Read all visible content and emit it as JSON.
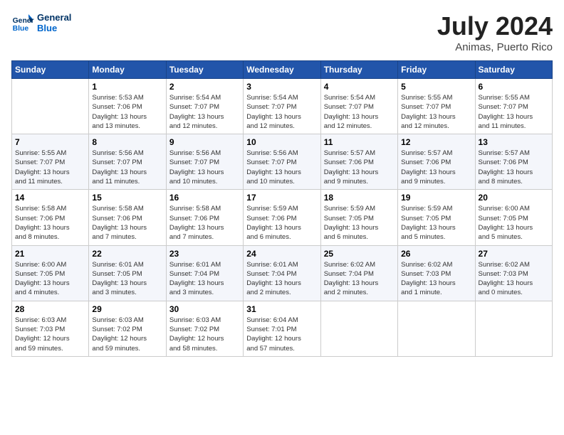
{
  "header": {
    "logo_line1": "General",
    "logo_line2": "Blue",
    "month_title": "July 2024",
    "location": "Animas, Puerto Rico"
  },
  "weekdays": [
    "Sunday",
    "Monday",
    "Tuesday",
    "Wednesday",
    "Thursday",
    "Friday",
    "Saturday"
  ],
  "weeks": [
    [
      {
        "day": "",
        "info": ""
      },
      {
        "day": "1",
        "info": "Sunrise: 5:53 AM\nSunset: 7:06 PM\nDaylight: 13 hours\nand 13 minutes."
      },
      {
        "day": "2",
        "info": "Sunrise: 5:54 AM\nSunset: 7:07 PM\nDaylight: 13 hours\nand 12 minutes."
      },
      {
        "day": "3",
        "info": "Sunrise: 5:54 AM\nSunset: 7:07 PM\nDaylight: 13 hours\nand 12 minutes."
      },
      {
        "day": "4",
        "info": "Sunrise: 5:54 AM\nSunset: 7:07 PM\nDaylight: 13 hours\nand 12 minutes."
      },
      {
        "day": "5",
        "info": "Sunrise: 5:55 AM\nSunset: 7:07 PM\nDaylight: 13 hours\nand 12 minutes."
      },
      {
        "day": "6",
        "info": "Sunrise: 5:55 AM\nSunset: 7:07 PM\nDaylight: 13 hours\nand 11 minutes."
      }
    ],
    [
      {
        "day": "7",
        "info": "Sunrise: 5:55 AM\nSunset: 7:07 PM\nDaylight: 13 hours\nand 11 minutes."
      },
      {
        "day": "8",
        "info": "Sunrise: 5:56 AM\nSunset: 7:07 PM\nDaylight: 13 hours\nand 11 minutes."
      },
      {
        "day": "9",
        "info": "Sunrise: 5:56 AM\nSunset: 7:07 PM\nDaylight: 13 hours\nand 10 minutes."
      },
      {
        "day": "10",
        "info": "Sunrise: 5:56 AM\nSunset: 7:07 PM\nDaylight: 13 hours\nand 10 minutes."
      },
      {
        "day": "11",
        "info": "Sunrise: 5:57 AM\nSunset: 7:06 PM\nDaylight: 13 hours\nand 9 minutes."
      },
      {
        "day": "12",
        "info": "Sunrise: 5:57 AM\nSunset: 7:06 PM\nDaylight: 13 hours\nand 9 minutes."
      },
      {
        "day": "13",
        "info": "Sunrise: 5:57 AM\nSunset: 7:06 PM\nDaylight: 13 hours\nand 8 minutes."
      }
    ],
    [
      {
        "day": "14",
        "info": "Sunrise: 5:58 AM\nSunset: 7:06 PM\nDaylight: 13 hours\nand 8 minutes."
      },
      {
        "day": "15",
        "info": "Sunrise: 5:58 AM\nSunset: 7:06 PM\nDaylight: 13 hours\nand 7 minutes."
      },
      {
        "day": "16",
        "info": "Sunrise: 5:58 AM\nSunset: 7:06 PM\nDaylight: 13 hours\nand 7 minutes."
      },
      {
        "day": "17",
        "info": "Sunrise: 5:59 AM\nSunset: 7:06 PM\nDaylight: 13 hours\nand 6 minutes."
      },
      {
        "day": "18",
        "info": "Sunrise: 5:59 AM\nSunset: 7:05 PM\nDaylight: 13 hours\nand 6 minutes."
      },
      {
        "day": "19",
        "info": "Sunrise: 5:59 AM\nSunset: 7:05 PM\nDaylight: 13 hours\nand 5 minutes."
      },
      {
        "day": "20",
        "info": "Sunrise: 6:00 AM\nSunset: 7:05 PM\nDaylight: 13 hours\nand 5 minutes."
      }
    ],
    [
      {
        "day": "21",
        "info": "Sunrise: 6:00 AM\nSunset: 7:05 PM\nDaylight: 13 hours\nand 4 minutes."
      },
      {
        "day": "22",
        "info": "Sunrise: 6:01 AM\nSunset: 7:05 PM\nDaylight: 13 hours\nand 3 minutes."
      },
      {
        "day": "23",
        "info": "Sunrise: 6:01 AM\nSunset: 7:04 PM\nDaylight: 13 hours\nand 3 minutes."
      },
      {
        "day": "24",
        "info": "Sunrise: 6:01 AM\nSunset: 7:04 PM\nDaylight: 13 hours\nand 2 minutes."
      },
      {
        "day": "25",
        "info": "Sunrise: 6:02 AM\nSunset: 7:04 PM\nDaylight: 13 hours\nand 2 minutes."
      },
      {
        "day": "26",
        "info": "Sunrise: 6:02 AM\nSunset: 7:03 PM\nDaylight: 13 hours\nand 1 minute."
      },
      {
        "day": "27",
        "info": "Sunrise: 6:02 AM\nSunset: 7:03 PM\nDaylight: 13 hours\nand 0 minutes."
      }
    ],
    [
      {
        "day": "28",
        "info": "Sunrise: 6:03 AM\nSunset: 7:03 PM\nDaylight: 12 hours\nand 59 minutes."
      },
      {
        "day": "29",
        "info": "Sunrise: 6:03 AM\nSunset: 7:02 PM\nDaylight: 12 hours\nand 59 minutes."
      },
      {
        "day": "30",
        "info": "Sunrise: 6:03 AM\nSunset: 7:02 PM\nDaylight: 12 hours\nand 58 minutes."
      },
      {
        "day": "31",
        "info": "Sunrise: 6:04 AM\nSunset: 7:01 PM\nDaylight: 12 hours\nand 57 minutes."
      },
      {
        "day": "",
        "info": ""
      },
      {
        "day": "",
        "info": ""
      },
      {
        "day": "",
        "info": ""
      }
    ]
  ]
}
